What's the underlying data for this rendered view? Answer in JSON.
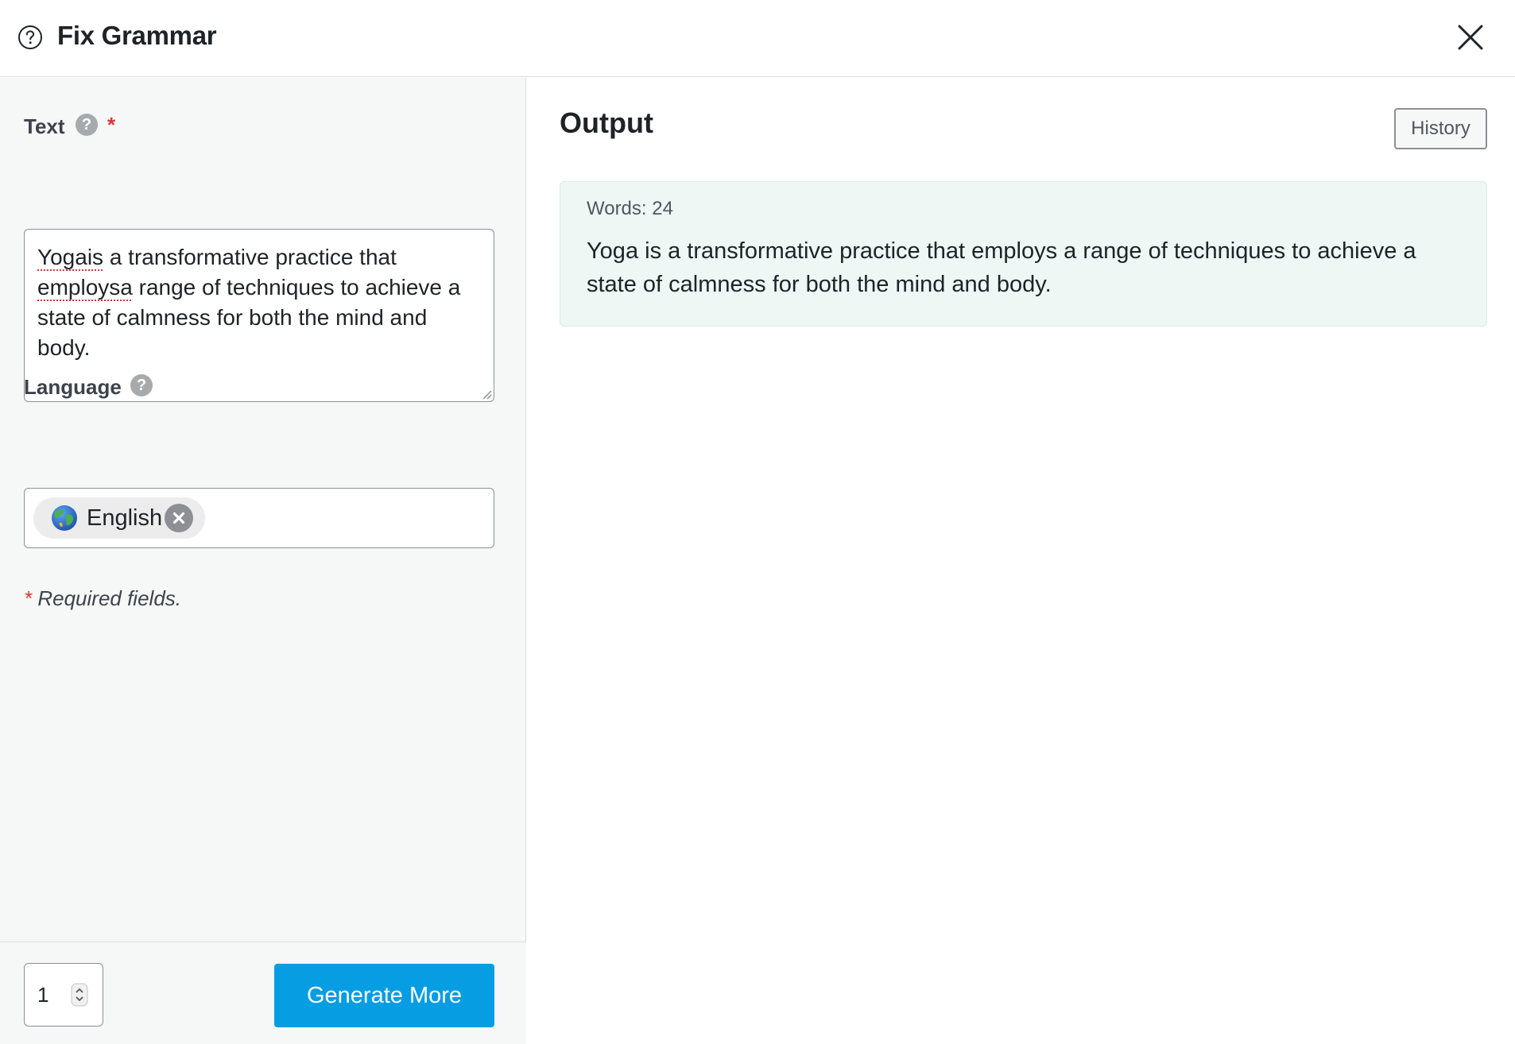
{
  "header": {
    "title": "Fix Grammar"
  },
  "form": {
    "text_label": "Text",
    "text_help": "?",
    "required_marker": "*",
    "text_parts": {
      "p1": "Yogais",
      "p2": " a transformative practice that ",
      "p3": "employsa",
      "p4": " range of techniques to achieve a state of calmness for both the mind and body."
    },
    "language_label": "Language",
    "language_help": "?",
    "language_selected": "English",
    "required_note_star": "*",
    "required_note": " Required fields."
  },
  "footer": {
    "quantity": "1",
    "generate_label": "Generate More"
  },
  "output": {
    "title": "Output",
    "history_label": "History",
    "word_count": "Words: 24",
    "result": "Yoga is a transformative practice that employs a range of techniques to achieve a state of calmness for both the mind and body."
  },
  "colors": {
    "primary_button": "#069de3",
    "required": "#d63638",
    "output_background": "#eef7f4",
    "panel_background": "#f6f7f7"
  },
  "icons": [
    "help-circle-icon",
    "close-icon",
    "help-icon",
    "globe-icon",
    "remove-icon",
    "spinner-icon",
    "resize-handle-icon"
  ]
}
